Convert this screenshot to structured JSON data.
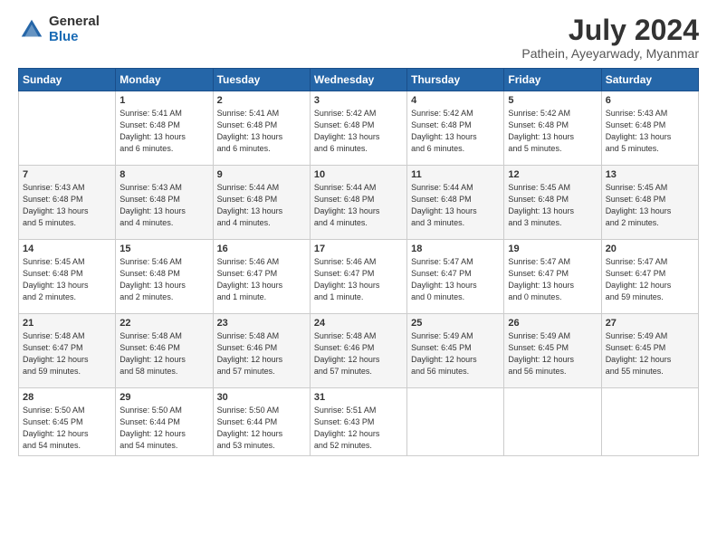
{
  "logo": {
    "general": "General",
    "blue": "Blue"
  },
  "header": {
    "title": "July 2024",
    "subtitle": "Pathein, Ayeyarwady, Myanmar"
  },
  "days_of_week": [
    "Sunday",
    "Monday",
    "Tuesday",
    "Wednesday",
    "Thursday",
    "Friday",
    "Saturday"
  ],
  "weeks": [
    [
      {
        "day": "",
        "info": ""
      },
      {
        "day": "1",
        "info": "Sunrise: 5:41 AM\nSunset: 6:48 PM\nDaylight: 13 hours\nand 6 minutes."
      },
      {
        "day": "2",
        "info": "Sunrise: 5:41 AM\nSunset: 6:48 PM\nDaylight: 13 hours\nand 6 minutes."
      },
      {
        "day": "3",
        "info": "Sunrise: 5:42 AM\nSunset: 6:48 PM\nDaylight: 13 hours\nand 6 minutes."
      },
      {
        "day": "4",
        "info": "Sunrise: 5:42 AM\nSunset: 6:48 PM\nDaylight: 13 hours\nand 6 minutes."
      },
      {
        "day": "5",
        "info": "Sunrise: 5:42 AM\nSunset: 6:48 PM\nDaylight: 13 hours\nand 5 minutes."
      },
      {
        "day": "6",
        "info": "Sunrise: 5:43 AM\nSunset: 6:48 PM\nDaylight: 13 hours\nand 5 minutes."
      }
    ],
    [
      {
        "day": "7",
        "info": "Sunrise: 5:43 AM\nSunset: 6:48 PM\nDaylight: 13 hours\nand 5 minutes."
      },
      {
        "day": "8",
        "info": "Sunrise: 5:43 AM\nSunset: 6:48 PM\nDaylight: 13 hours\nand 4 minutes."
      },
      {
        "day": "9",
        "info": "Sunrise: 5:44 AM\nSunset: 6:48 PM\nDaylight: 13 hours\nand 4 minutes."
      },
      {
        "day": "10",
        "info": "Sunrise: 5:44 AM\nSunset: 6:48 PM\nDaylight: 13 hours\nand 4 minutes."
      },
      {
        "day": "11",
        "info": "Sunrise: 5:44 AM\nSunset: 6:48 PM\nDaylight: 13 hours\nand 3 minutes."
      },
      {
        "day": "12",
        "info": "Sunrise: 5:45 AM\nSunset: 6:48 PM\nDaylight: 13 hours\nand 3 minutes."
      },
      {
        "day": "13",
        "info": "Sunrise: 5:45 AM\nSunset: 6:48 PM\nDaylight: 13 hours\nand 2 minutes."
      }
    ],
    [
      {
        "day": "14",
        "info": "Sunrise: 5:45 AM\nSunset: 6:48 PM\nDaylight: 13 hours\nand 2 minutes."
      },
      {
        "day": "15",
        "info": "Sunrise: 5:46 AM\nSunset: 6:48 PM\nDaylight: 13 hours\nand 2 minutes."
      },
      {
        "day": "16",
        "info": "Sunrise: 5:46 AM\nSunset: 6:47 PM\nDaylight: 13 hours\nand 1 minute."
      },
      {
        "day": "17",
        "info": "Sunrise: 5:46 AM\nSunset: 6:47 PM\nDaylight: 13 hours\nand 1 minute."
      },
      {
        "day": "18",
        "info": "Sunrise: 5:47 AM\nSunset: 6:47 PM\nDaylight: 13 hours\nand 0 minutes."
      },
      {
        "day": "19",
        "info": "Sunrise: 5:47 AM\nSunset: 6:47 PM\nDaylight: 13 hours\nand 0 minutes."
      },
      {
        "day": "20",
        "info": "Sunrise: 5:47 AM\nSunset: 6:47 PM\nDaylight: 12 hours\nand 59 minutes."
      }
    ],
    [
      {
        "day": "21",
        "info": "Sunrise: 5:48 AM\nSunset: 6:47 PM\nDaylight: 12 hours\nand 59 minutes."
      },
      {
        "day": "22",
        "info": "Sunrise: 5:48 AM\nSunset: 6:46 PM\nDaylight: 12 hours\nand 58 minutes."
      },
      {
        "day": "23",
        "info": "Sunrise: 5:48 AM\nSunset: 6:46 PM\nDaylight: 12 hours\nand 57 minutes."
      },
      {
        "day": "24",
        "info": "Sunrise: 5:48 AM\nSunset: 6:46 PM\nDaylight: 12 hours\nand 57 minutes."
      },
      {
        "day": "25",
        "info": "Sunrise: 5:49 AM\nSunset: 6:45 PM\nDaylight: 12 hours\nand 56 minutes."
      },
      {
        "day": "26",
        "info": "Sunrise: 5:49 AM\nSunset: 6:45 PM\nDaylight: 12 hours\nand 56 minutes."
      },
      {
        "day": "27",
        "info": "Sunrise: 5:49 AM\nSunset: 6:45 PM\nDaylight: 12 hours\nand 55 minutes."
      }
    ],
    [
      {
        "day": "28",
        "info": "Sunrise: 5:50 AM\nSunset: 6:45 PM\nDaylight: 12 hours\nand 54 minutes."
      },
      {
        "day": "29",
        "info": "Sunrise: 5:50 AM\nSunset: 6:44 PM\nDaylight: 12 hours\nand 54 minutes."
      },
      {
        "day": "30",
        "info": "Sunrise: 5:50 AM\nSunset: 6:44 PM\nDaylight: 12 hours\nand 53 minutes."
      },
      {
        "day": "31",
        "info": "Sunrise: 5:51 AM\nSunset: 6:43 PM\nDaylight: 12 hours\nand 52 minutes."
      },
      {
        "day": "",
        "info": ""
      },
      {
        "day": "",
        "info": ""
      },
      {
        "day": "",
        "info": ""
      }
    ]
  ]
}
